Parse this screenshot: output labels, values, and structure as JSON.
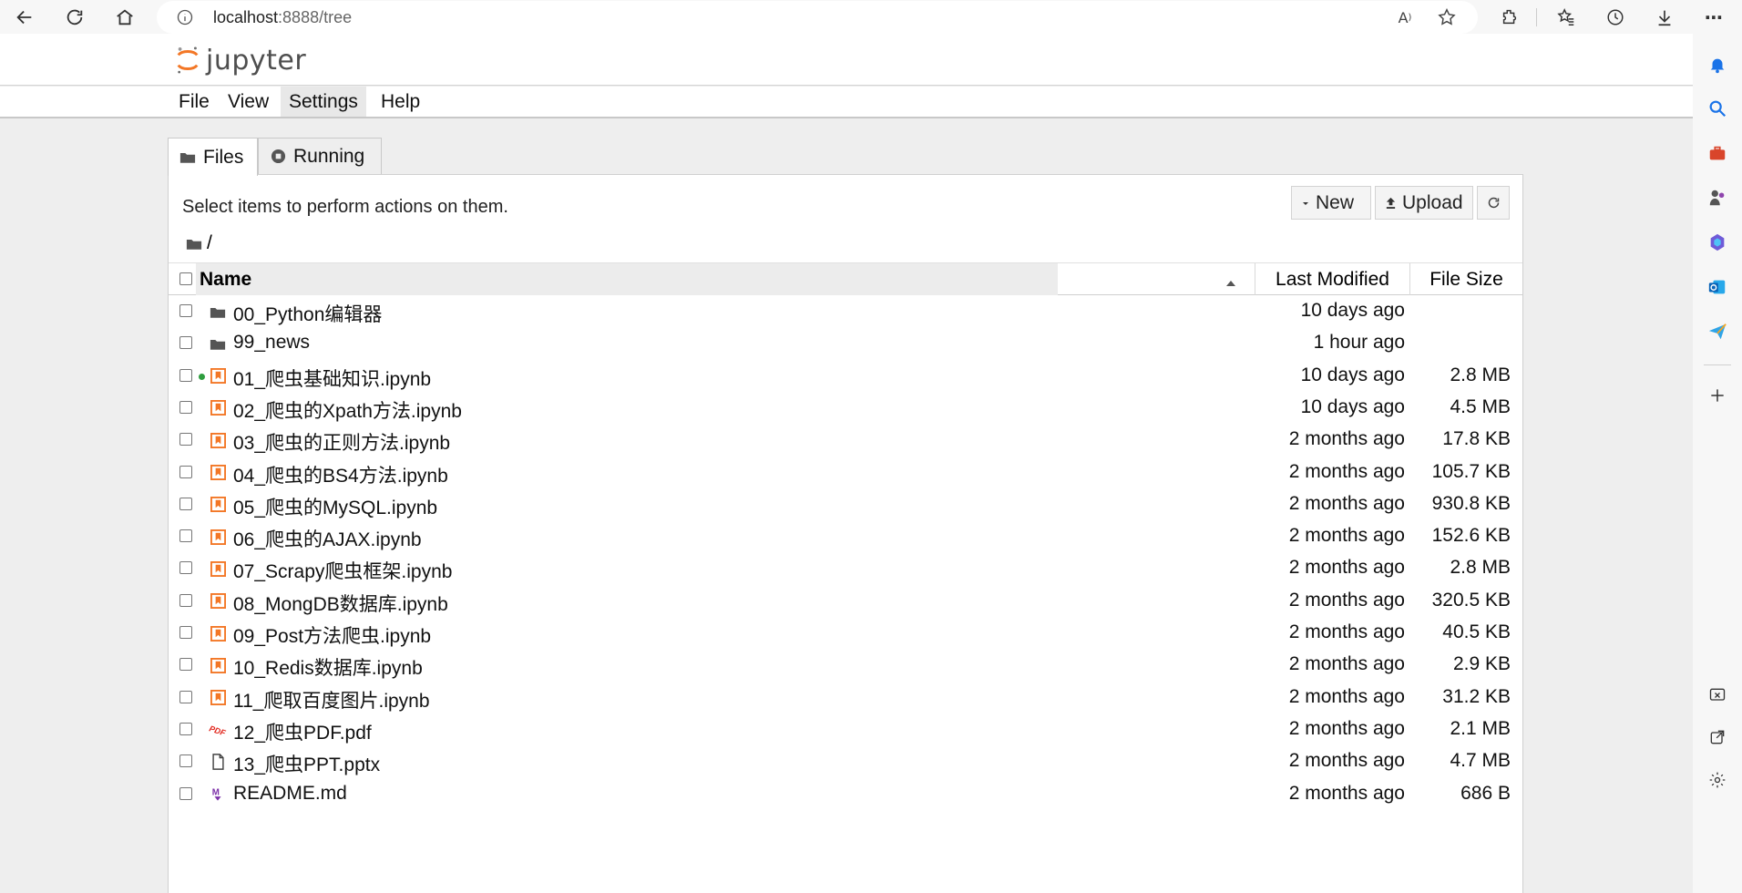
{
  "browser": {
    "url_host": "localhost",
    "url_path": ":8888/tree"
  },
  "jupyter": {
    "logo_text": "jupyter",
    "menu": [
      "File",
      "View",
      "Settings",
      "Help"
    ],
    "active_menu_index": 2,
    "tabs": [
      "Files",
      "Running"
    ],
    "hint": "Select items to perform actions on them.",
    "buttons": {
      "new": "New",
      "upload": "Upload"
    },
    "breadcrumb": "/",
    "columns": {
      "name": "Name",
      "modified": "Last Modified",
      "size": "File Size"
    },
    "files": [
      {
        "name": "00_Python编辑器",
        "type": "folder",
        "modified": "10 days ago",
        "size": ""
      },
      {
        "name": "99_news",
        "type": "folder",
        "modified": "1 hour ago",
        "size": ""
      },
      {
        "name": "01_爬虫基础知识.ipynb",
        "type": "notebook",
        "running": true,
        "modified": "10 days ago",
        "size": "2.8 MB"
      },
      {
        "name": "02_爬虫的Xpath方法.ipynb",
        "type": "notebook",
        "modified": "10 days ago",
        "size": "4.5 MB"
      },
      {
        "name": "03_爬虫的正则方法.ipynb",
        "type": "notebook",
        "modified": "2 months ago",
        "size": "17.8 KB"
      },
      {
        "name": "04_爬虫的BS4方法.ipynb",
        "type": "notebook",
        "modified": "2 months ago",
        "size": "105.7 KB"
      },
      {
        "name": "05_爬虫的MySQL.ipynb",
        "type": "notebook",
        "modified": "2 months ago",
        "size": "930.8 KB"
      },
      {
        "name": "06_爬虫的AJAX.ipynb",
        "type": "notebook",
        "modified": "2 months ago",
        "size": "152.6 KB"
      },
      {
        "name": "07_Scrapy爬虫框架.ipynb",
        "type": "notebook",
        "modified": "2 months ago",
        "size": "2.8 MB"
      },
      {
        "name": "08_MongDB数据库.ipynb",
        "type": "notebook",
        "modified": "2 months ago",
        "size": "320.5 KB"
      },
      {
        "name": "09_Post方法爬虫.ipynb",
        "type": "notebook",
        "modified": "2 months ago",
        "size": "40.5 KB"
      },
      {
        "name": "10_Redis数据库.ipynb",
        "type": "notebook",
        "modified": "2 months ago",
        "size": "2.9 KB"
      },
      {
        "name": "11_爬取百度图片.ipynb",
        "type": "notebook",
        "modified": "2 months ago",
        "size": "31.2 KB"
      },
      {
        "name": "12_爬虫PDF.pdf",
        "type": "pdf",
        "modified": "2 months ago",
        "size": "2.1 MB"
      },
      {
        "name": "13_爬虫PPT.pptx",
        "type": "file",
        "modified": "2 months ago",
        "size": "4.7 MB"
      },
      {
        "name": "README.md",
        "type": "markdown",
        "modified": "2 months ago",
        "size": "686 B"
      }
    ]
  },
  "colors": {
    "notebook_icon": "#f37726",
    "running_dot": "#2e9d3e",
    "pdf_icon": "#e1251b",
    "markdown_icon": "#7b2fa8",
    "jupyter_orange": "#f37726"
  }
}
